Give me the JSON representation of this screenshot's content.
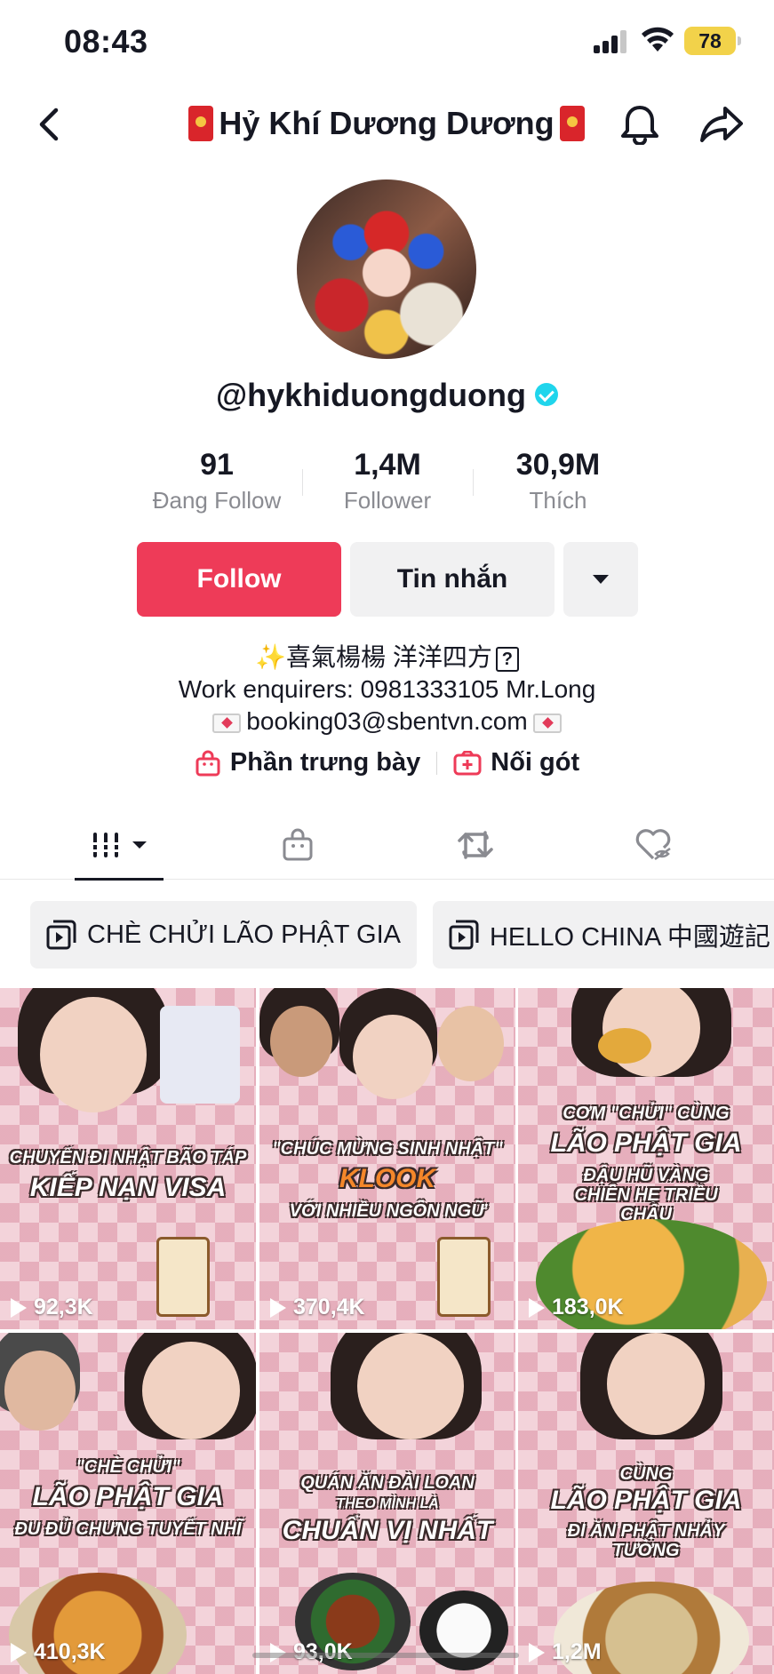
{
  "status_bar": {
    "time": "08:43",
    "battery": "78"
  },
  "header": {
    "title": "Hỷ Khí Dương Dương"
  },
  "profile": {
    "username": "@hykhiduongduong",
    "stats": [
      {
        "value": "91",
        "label": "Đang Follow"
      },
      {
        "value": "1,4M",
        "label": "Follower"
      },
      {
        "value": "30,9M",
        "label": "Thích"
      }
    ],
    "buttons": {
      "follow": "Follow",
      "message": "Tin nhắn"
    },
    "bio": {
      "line1": "✨喜氣楊楊 洋洋四方",
      "line1_box": "?",
      "line2": "Work enquirers: 0981333105 Mr.Long",
      "line3": "booking03@sbentvn.com"
    },
    "links": {
      "showcase": "Phần trưng bày",
      "duet": "Nối gót"
    }
  },
  "playlists": [
    {
      "label": "CHÈ CHỬI LÃO PHẬT GIA"
    },
    {
      "label": "HELLO CHINA 中國遊記"
    }
  ],
  "videos": [
    {
      "cap_small": "CHUYẾN ĐI NHẬT BÃO TÁP",
      "cap_big": "KIẾP NẠN VISA",
      "cap_small2": "",
      "views": "92,3K"
    },
    {
      "cap_small": "\"CHÚC MỪNG SINH NHẬT\"",
      "cap_big": "KLOOK",
      "cap_small2": "VỚI NHIỀU NGÔN NGỮ",
      "views": "370,4K"
    },
    {
      "cap_small": "CƠM \"CHỬI\" CÙNG",
      "cap_big": "LÃO PHẬT GIA",
      "cap_small2": "ĐẬU HŨ VÀNG CHIÊN HẸ TRIỀU CHÂU",
      "views": "183,0K"
    },
    {
      "cap_small": "\"CHÈ CHỬI\"",
      "cap_big": "LÃO PHẬT GIA",
      "cap_small2": "ĐU ĐỦ CHƯNG TUYẾT NHĨ",
      "views": "410,3K"
    },
    {
      "cap_small": "QUÁN ĂN ĐÀI LOAN",
      "cap_big": "CHUẨN VỊ NHẤT",
      "cap_small2": "THEO MÌNH LÀ",
      "views": "93,0K"
    },
    {
      "cap_small": "CÙNG",
      "cap_big": "LÃO PHẬT GIA",
      "cap_small2": "ĐI ĂN PHẬT NHẢY TƯỜNG",
      "views": "1,2M"
    }
  ],
  "colors": {
    "follow": "#ee3b58",
    "verified": "#20d5ec",
    "battery": "#f2d24a"
  }
}
